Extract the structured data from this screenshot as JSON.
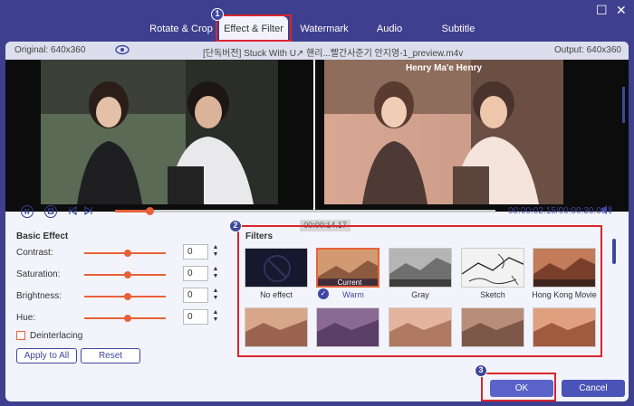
{
  "tabs": [
    {
      "label": "Rotate & Crop",
      "active": false
    },
    {
      "label": "Effect & Filter",
      "active": true
    },
    {
      "label": "Watermark",
      "active": false
    },
    {
      "label": "Audio",
      "active": false
    },
    {
      "label": "Subtitle",
      "active": false
    }
  ],
  "infobar": {
    "original": "Original: 640x360",
    "filename": "[단독버전] Stuck With U↗ 핸리...빨간사준기 안지영-1_preview.m4v",
    "output": "Output: 640x360"
  },
  "watermark_text": "Henry Ma'e Henry",
  "playback": {
    "time": "00:00:02.15/00:00:30.00",
    "tooltip": "00:00:14.17",
    "progress": 0.09
  },
  "basic_effect": {
    "title": "Basic Effect",
    "rows": [
      {
        "label": "Contrast:",
        "value": "0"
      },
      {
        "label": "Saturation:",
        "value": "0"
      },
      {
        "label": "Brightness:",
        "value": "0"
      },
      {
        "label": "Hue:",
        "value": "0"
      }
    ],
    "deinterlacing": "Deinterlacing",
    "apply_all": "Apply to All",
    "reset": "Reset"
  },
  "filters": {
    "title": "Filters",
    "items": [
      {
        "label": "No effect"
      },
      {
        "label": "Warm",
        "current": "Current"
      },
      {
        "label": "Gray"
      },
      {
        "label": "Sketch"
      },
      {
        "label": "Hong Kong Movie"
      }
    ]
  },
  "badges": [
    "1",
    "2",
    "3"
  ],
  "buttons": {
    "ok": "OK",
    "cancel": "Cancel"
  },
  "colors": {
    "accent": "#e8613a",
    "brand": "#3d47a0",
    "highlight": "#d8262e"
  }
}
